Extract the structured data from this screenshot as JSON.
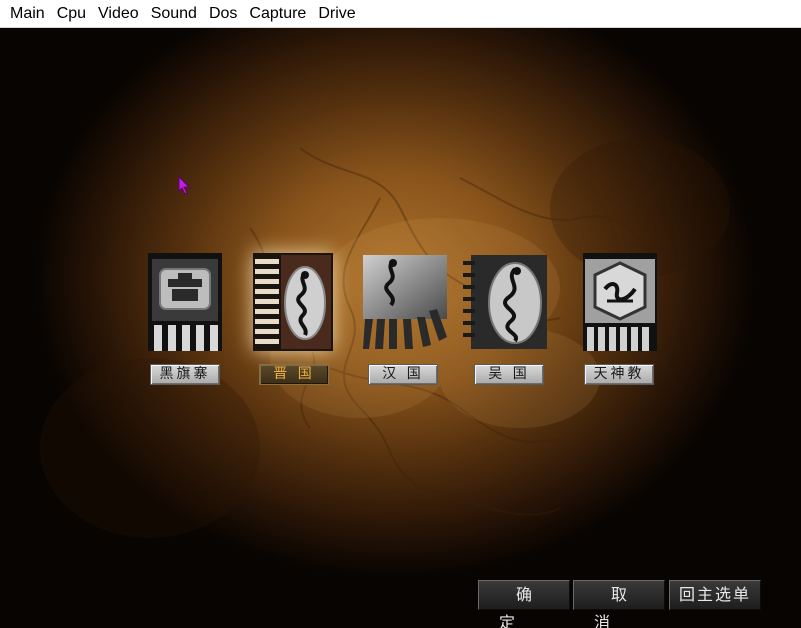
{
  "menubar": {
    "items": [
      "Main",
      "Cpu",
      "Video",
      "Sound",
      "Dos",
      "Capture",
      "Drive"
    ]
  },
  "factions": [
    {
      "label": "黑旗寨",
      "emblem": "black-flag-fortress-emblem-icon",
      "selected": false
    },
    {
      "label": "晋 国",
      "emblem": "jin-dragon-emblem-icon",
      "selected": true
    },
    {
      "label": "汉 国",
      "emblem": "han-dragon-emblem-icon",
      "selected": false
    },
    {
      "label": "吴 国",
      "emblem": "wu-dragon-emblem-icon",
      "selected": false
    },
    {
      "label": "天神教",
      "emblem": "tianshen-sect-emblem-icon",
      "selected": false
    }
  ],
  "buttons": {
    "confirm": "确定",
    "cancel": "取消",
    "main_menu": "回主选单"
  },
  "colors": {
    "selected_label_text": "#f0b040",
    "map_base": "#9a5e22"
  }
}
